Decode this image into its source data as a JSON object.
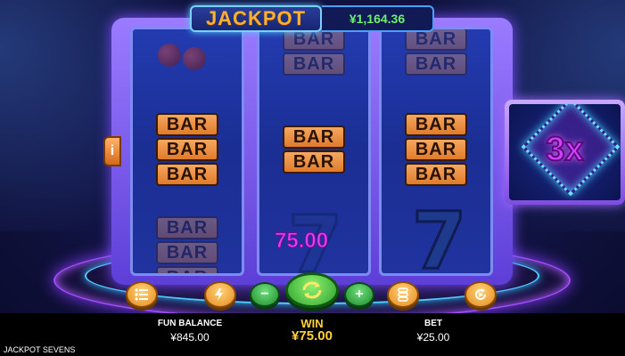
{
  "jackpot": {
    "label": "JACKPOT",
    "value": "¥1,164.36"
  },
  "info_button": {
    "label": "i"
  },
  "multiplier": {
    "label": "3x"
  },
  "reels": [
    {
      "visible_symbols": [
        "cherry",
        "BAR",
        "BAR",
        "BAR",
        "BAR"
      ]
    },
    {
      "visible_symbols": [
        "BAR",
        "BAR",
        "BAR",
        "BAR",
        "seven"
      ]
    },
    {
      "visible_symbols": [
        "BAR",
        "BAR",
        "BAR",
        "BAR",
        "seven"
      ]
    }
  ],
  "bar_symbol_text": "BAR",
  "reel_win_amount": "75.00",
  "controls": {
    "menu_icon": "menu-icon",
    "turbo_icon": "lightning-icon",
    "decrease_label": "−",
    "spin_icon": "spin-arrows-icon",
    "increase_label": "+",
    "bet_stack_icon": "coin-stack-icon",
    "autoplay_icon": "autoplay-icon"
  },
  "footer": {
    "balance_label": "FUN BALANCE",
    "balance_value": "¥845.00",
    "win_label": "WIN",
    "win_value": "¥75.00",
    "bet_label": "BET",
    "bet_value": "¥25.00",
    "game_title": "JACKPOT SEVENS"
  },
  "colors": {
    "jackpot_text": "#ffb030",
    "jackpot_value": "#6cf06c",
    "win_text": "#ffd23a",
    "reel_win": "#e040ff",
    "multiplier": "#d040ff"
  }
}
